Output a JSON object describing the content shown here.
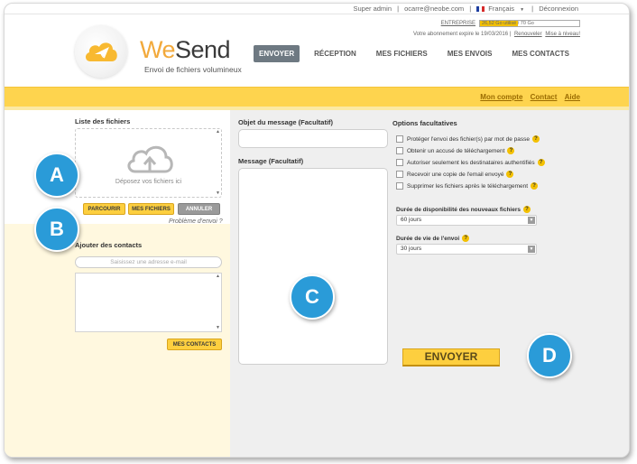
{
  "topbar": {
    "role": "Super admin",
    "email": "ocarre@neobe.com",
    "language": "Français",
    "logout": "Déconnexion",
    "sep": "|",
    "dropdown_glyph": "▼"
  },
  "quota": {
    "label": "ENTREPRISE",
    "used_fraction": 0.38,
    "text": "26,52 Go utilisé / 70 Go",
    "expire_text": "Votre abonnement expire le 19/03/2016 |",
    "renew": "Renouveler",
    "upgrade": "Mise à niveau!"
  },
  "brand": {
    "name_part1": "We",
    "name_part2": "Send",
    "tagline": "Envoi de fichiers volumineux"
  },
  "nav": {
    "items": [
      "ENVOYER",
      "RÉCEPTION",
      "MES FICHIERS",
      "MES ENVOIS",
      "MES CONTACTS"
    ],
    "active": "ENVOYER"
  },
  "band": {
    "links": [
      "Mon compte",
      "Contact",
      "Aide"
    ]
  },
  "files": {
    "title": "Liste des fichiers",
    "drop_text": "Déposez vos fichiers ici",
    "browse": "PARCOURIR",
    "my_files": "MES FICHIERS",
    "cancel": "ANNULER",
    "problem": "Problème d'envoi ?"
  },
  "contacts": {
    "title": "Ajouter des contacts",
    "placeholder": "Saisissez une adresse e-mail",
    "my_contacts": "MES CONTACTS"
  },
  "message": {
    "subject_label": "Objet du message (Facultatif)",
    "body_label": "Message (Facultatif)"
  },
  "options": {
    "title": "Options facultatives",
    "help_glyph": "?",
    "items": [
      "Protéger l'envoi des fichier(s) par mot de passe",
      "Obtenir un accusé de téléchargement",
      "Autoriser seulement les destinataires authentifiés",
      "Recevoir une copie de l'email envoyé",
      "Supprimer les fichiers après le téléchargement"
    ],
    "availability_label": "Durée de disponibilité des nouveaux fichiers",
    "availability_value": "60 jours",
    "lifetime_label": "Durée de vie de l'envoi",
    "lifetime_value": "30 jours"
  },
  "send_button": "ENVOYER",
  "markers": [
    "A",
    "B",
    "C",
    "D"
  ],
  "colors": {
    "accent_yellow": "#fed44e",
    "button_yellow": "#fdcf3f",
    "marker_blue": "#2a9bd8",
    "nav_active": "#6e7982"
  }
}
